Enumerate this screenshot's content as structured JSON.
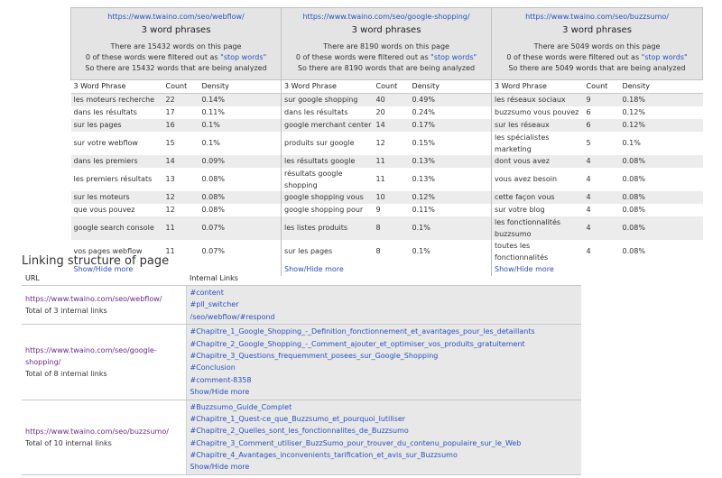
{
  "phrase_blocks": [
    {
      "url": "https://www.twaino.com/seo/webflow/",
      "title": "3 word phrases",
      "info": [
        "There are 15432 words on this page",
        "0 of these words were filtered out as ",
        "So there are 15432 words that are being analyzed"
      ],
      "rows": [
        [
          "les moteurs recherche",
          "22",
          "0.14%"
        ],
        [
          "dans les résultats",
          "17",
          "0.11%"
        ],
        [
          "sur les pages",
          "16",
          "0.1%"
        ],
        [
          "sur votre webflow",
          "15",
          "0.1%"
        ],
        [
          "dans les premiers",
          "14",
          "0.09%"
        ],
        [
          "les premiers résultats",
          "13",
          "0.08%"
        ],
        [
          "sur les moteurs",
          "12",
          "0.08%"
        ],
        [
          "que vous pouvez",
          "12",
          "0.08%"
        ],
        [
          "google search console",
          "11",
          "0.07%"
        ],
        [
          "vos pages webflow",
          "11",
          "0.07%"
        ]
      ]
    },
    {
      "url": "https://www.twaino.com/seo/google-shopping/",
      "title": "3 word phrases",
      "info": [
        "There are 8190 words on this page",
        "0 of these words were filtered out as ",
        "So there are 8190 words that are being analyzed"
      ],
      "rows": [
        [
          "sur google shopping",
          "40",
          "0.49%"
        ],
        [
          "dans les résultats",
          "20",
          "0.24%"
        ],
        [
          "google merchant center",
          "14",
          "0.17%"
        ],
        [
          "produits sur google",
          "12",
          "0.15%"
        ],
        [
          "les résultats google",
          "11",
          "0.13%"
        ],
        [
          "résultats google shopping",
          "11",
          "0.13%"
        ],
        [
          "google shopping vous",
          "10",
          "0.12%"
        ],
        [
          "google shopping pour",
          "9",
          "0.11%"
        ],
        [
          "les listes produits",
          "8",
          "0.1%"
        ],
        [
          "sur les pages",
          "8",
          "0.1%"
        ]
      ]
    },
    {
      "url": "https://www.twaino.com/seo/buzzsumo/",
      "title": "3 word phrases",
      "info": [
        "There are 5049 words on this page",
        "0 of these words were filtered out as ",
        "So there are 5049 words that are being analyzed"
      ],
      "rows": [
        [
          "les réseaux sociaux",
          "9",
          "0.18%"
        ],
        [
          "buzzsumo vous pouvez",
          "6",
          "0.12%"
        ],
        [
          "sur les réseaux",
          "6",
          "0.12%"
        ],
        [
          "les spécialistes marketing",
          "5",
          "0.1%"
        ],
        [
          "dont vous avez",
          "4",
          "0.08%"
        ],
        [
          "vous avez besoin",
          "4",
          "0.08%"
        ],
        [
          "cette façon vous",
          "4",
          "0.08%"
        ],
        [
          "sur votre blog",
          "4",
          "0.08%"
        ],
        [
          "les fonctionnalités buzzsumo",
          "4",
          "0.08%"
        ],
        [
          "toutes les fonctionnalités",
          "4",
          "0.08%"
        ]
      ]
    }
  ],
  "stop_words_link": "\"stop words\"",
  "columns": {
    "phrase": "3 Word Phrase",
    "count": "Count",
    "density": "Density"
  },
  "show_hide": "Show/Hide more",
  "linking": {
    "title": "Linking structure of page",
    "col_url": "URL",
    "col_links": "Internal Links",
    "groups": [
      {
        "url": "https://www.twaino.com/seo/webflow/",
        "total": "Total of 3 internal links",
        "links": [
          "#content",
          "#pll_switcher",
          "/seo/webflow/#respond"
        ],
        "show_more": false
      },
      {
        "url": "https://www.twaino.com/seo/google-shopping/",
        "total": "Total of 8 internal links",
        "links": [
          "#Chapitre_1_Google_Shopping_-_Definition_fonctionnement_et_avantages_pour_les_detaillants",
          "#Chapitre_2_Google_Shopping_-_Comment_ajouter_et_optimiser_vos_produits_gratuitement",
          "#Chapitre_3_Questions_frequemment_posees_sur_Google_Shopping",
          "#Conclusion",
          "#comment-8358"
        ],
        "show_more": true
      },
      {
        "url": "https://www.twaino.com/seo/buzzsumo/",
        "total": "Total of 10 internal links",
        "links": [
          "#Buzzsumo_Guide_Complet",
          "#Chapitre_1_Quest-ce_que_Buzzsumo_et_pourquoi_lutiliser",
          "#Chapitre_2_Quelles_sont_les_fonctionnalites_de_Buzzsumo",
          "#Chapitre_3_Comment_utiliser_BuzzSumo_pour_trouver_du_contenu_populaire_sur_le_Web",
          "#Chapitre_4_Avantages_inconvenients_tarification_et_avis_sur_Buzzsumo"
        ],
        "show_more": true
      }
    ]
  },
  "colors": {
    "link": "#2a52be",
    "visited_url": "#6a2a8a",
    "header_bg": "#e4e4e4",
    "stripe_bg": "#ececec"
  }
}
